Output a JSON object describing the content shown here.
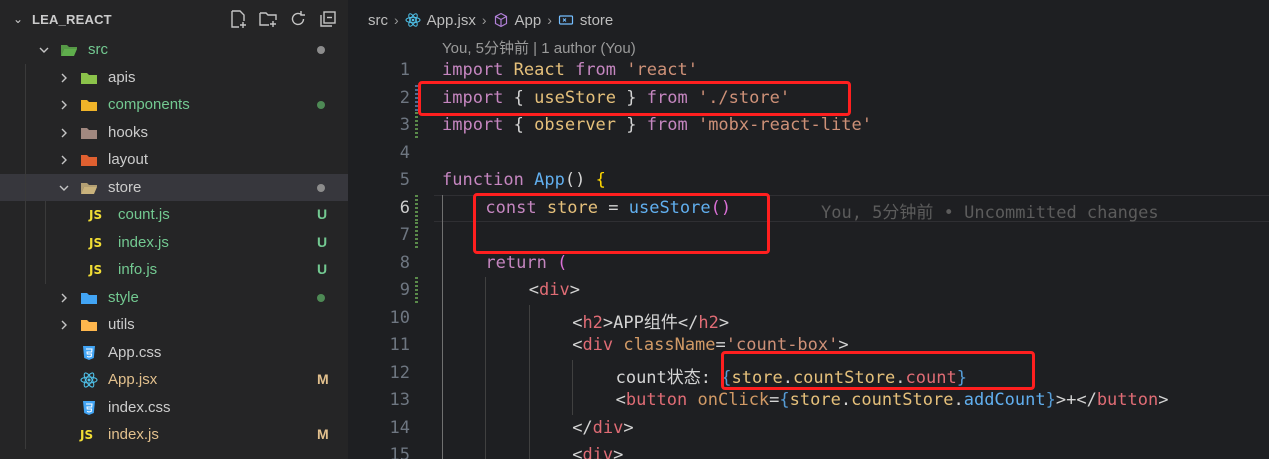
{
  "explorer": {
    "project_title": "LEA_REACT",
    "tree": [
      {
        "label": "src",
        "kind": "folder-src",
        "expanded": true,
        "depth": 0,
        "color": "green",
        "status": "dot"
      },
      {
        "label": "apis",
        "kind": "folder-apis",
        "expanded": false,
        "depth": 1,
        "color": "normal",
        "status": ""
      },
      {
        "label": "components",
        "kind": "folder-components",
        "expanded": false,
        "depth": 1,
        "color": "green",
        "status": "dot-green"
      },
      {
        "label": "hooks",
        "kind": "folder-hooks",
        "expanded": false,
        "depth": 1,
        "color": "normal",
        "status": ""
      },
      {
        "label": "layout",
        "kind": "folder-layout",
        "expanded": false,
        "depth": 1,
        "color": "normal",
        "status": ""
      },
      {
        "label": "store",
        "kind": "folder-store",
        "expanded": true,
        "depth": 1,
        "color": "normal",
        "status": "dot",
        "selected": true
      },
      {
        "label": "count.js",
        "kind": "js",
        "depth": 2,
        "color": "green",
        "status": "U"
      },
      {
        "label": "index.js",
        "kind": "js",
        "depth": 2,
        "color": "green",
        "status": "U"
      },
      {
        "label": "info.js",
        "kind": "js",
        "depth": 2,
        "color": "green",
        "status": "U"
      },
      {
        "label": "style",
        "kind": "folder-style",
        "expanded": false,
        "depth": 1,
        "color": "green",
        "status": "dot-green"
      },
      {
        "label": "utils",
        "kind": "folder-utils",
        "expanded": false,
        "depth": 1,
        "color": "normal",
        "status": ""
      },
      {
        "label": "App.css",
        "kind": "css",
        "depth": 1,
        "color": "normal",
        "status": ""
      },
      {
        "label": "App.jsx",
        "kind": "react",
        "depth": 1,
        "color": "yellow",
        "status": "M"
      },
      {
        "label": "index.css",
        "kind": "css",
        "depth": 1,
        "color": "normal",
        "status": ""
      },
      {
        "label": "index.js",
        "kind": "js",
        "depth": 1,
        "color": "yellow",
        "status": "M"
      }
    ]
  },
  "breadcrumb": {
    "folder": "src",
    "file": "App.jsx",
    "component": "App",
    "symbol": "store"
  },
  "blame_header": "You, 5分钟前 | 1 author (You)",
  "inline_blame": "You, 5分钟前 • Uncommitted changes",
  "active_line": 6,
  "code_lines": [
    {
      "n": "1",
      "tokens": [
        [
          "import",
          "k-purple"
        ],
        [
          " React ",
          "k-var"
        ],
        [
          "from",
          "k-purple"
        ],
        [
          " ",
          "k-plain"
        ],
        [
          "'react'",
          "k-orange"
        ]
      ]
    },
    {
      "n": "2",
      "tokens": [
        [
          "import",
          "k-purple"
        ],
        [
          " { ",
          "k-plain"
        ],
        [
          "useStore",
          "k-var"
        ],
        [
          " } ",
          "k-plain"
        ],
        [
          "from",
          "k-purple"
        ],
        [
          " ",
          "k-plain"
        ],
        [
          "'./store'",
          "k-orange"
        ]
      ]
    },
    {
      "n": "3",
      "tokens": [
        [
          "import",
          "k-purple"
        ],
        [
          " { ",
          "k-plain"
        ],
        [
          "observer",
          "k-var"
        ],
        [
          " } ",
          "k-plain"
        ],
        [
          "from",
          "k-purple"
        ],
        [
          " ",
          "k-plain"
        ],
        [
          "'mobx-react-lite'",
          "k-orange"
        ]
      ]
    },
    {
      "n": "4",
      "tokens": []
    },
    {
      "n": "5",
      "tokens": [
        [
          "function",
          "k-purple"
        ],
        [
          " ",
          "k-plain"
        ],
        [
          "App",
          "k-fn"
        ],
        [
          "() ",
          "k-plain"
        ],
        [
          "{",
          "k-gold"
        ]
      ]
    },
    {
      "n": "6",
      "tokens": [
        [
          "const",
          "k-purple"
        ],
        [
          " ",
          "k-plain"
        ],
        [
          "store",
          "k-var"
        ],
        [
          " = ",
          "k-plain"
        ],
        [
          "useStore",
          "k-fn"
        ],
        [
          "()",
          "k-pink"
        ]
      ]
    },
    {
      "n": "7",
      "tokens": []
    },
    {
      "n": "8",
      "tokens": [
        [
          "return",
          "k-purple"
        ],
        [
          " ",
          "k-plain"
        ],
        [
          "(",
          "k-pink"
        ]
      ]
    },
    {
      "n": "9",
      "tokens": [
        [
          "<",
          "k-plain"
        ],
        [
          "div",
          "k-tag"
        ],
        [
          ">",
          "k-plain"
        ]
      ]
    },
    {
      "n": "10",
      "tokens": [
        [
          "<",
          "k-plain"
        ],
        [
          "h2",
          "k-tag"
        ],
        [
          ">APP组件</",
          "k-plain"
        ],
        [
          "h2",
          "k-tag"
        ],
        [
          ">",
          "k-plain"
        ]
      ]
    },
    {
      "n": "11",
      "tokens": [
        [
          "<",
          "k-plain"
        ],
        [
          "div",
          "k-tag"
        ],
        [
          " ",
          "k-plain"
        ],
        [
          "className",
          "k-attr"
        ],
        [
          "=",
          "k-plain"
        ],
        [
          "'count-box'",
          "k-orange"
        ],
        [
          ">",
          "k-plain"
        ]
      ]
    },
    {
      "n": "12",
      "tokens": [
        [
          "count状态: ",
          "k-plain"
        ],
        [
          "{",
          "k-blue"
        ],
        [
          "store",
          "k-var"
        ],
        [
          ".",
          "k-plain"
        ],
        [
          "countStore",
          "k-var"
        ],
        [
          ".",
          "k-plain"
        ],
        [
          "count",
          "k-prop"
        ],
        [
          "}",
          "k-blue"
        ]
      ]
    },
    {
      "n": "13",
      "tokens": [
        [
          "<",
          "k-plain"
        ],
        [
          "button",
          "k-tag"
        ],
        [
          " ",
          "k-plain"
        ],
        [
          "onClick",
          "k-attr"
        ],
        [
          "=",
          "k-plain"
        ],
        [
          "{",
          "k-blue"
        ],
        [
          "store",
          "k-var"
        ],
        [
          ".",
          "k-plain"
        ],
        [
          "countStore",
          "k-var"
        ],
        [
          ".",
          "k-plain"
        ],
        [
          "addCount",
          "k-fn"
        ],
        [
          "}",
          "k-blue"
        ],
        [
          ">+</",
          "k-plain"
        ],
        [
          "button",
          "k-tag"
        ],
        [
          ">",
          "k-plain"
        ]
      ]
    },
    {
      "n": "14",
      "tokens": [
        [
          "</",
          "k-plain"
        ],
        [
          "div",
          "k-tag"
        ],
        [
          ">",
          "k-plain"
        ]
      ]
    },
    {
      "n": "15",
      "tokens": [
        [
          "<",
          "k-plain"
        ],
        [
          "div",
          "k-tag"
        ],
        [
          ">",
          "k-plain"
        ]
      ]
    }
  ]
}
